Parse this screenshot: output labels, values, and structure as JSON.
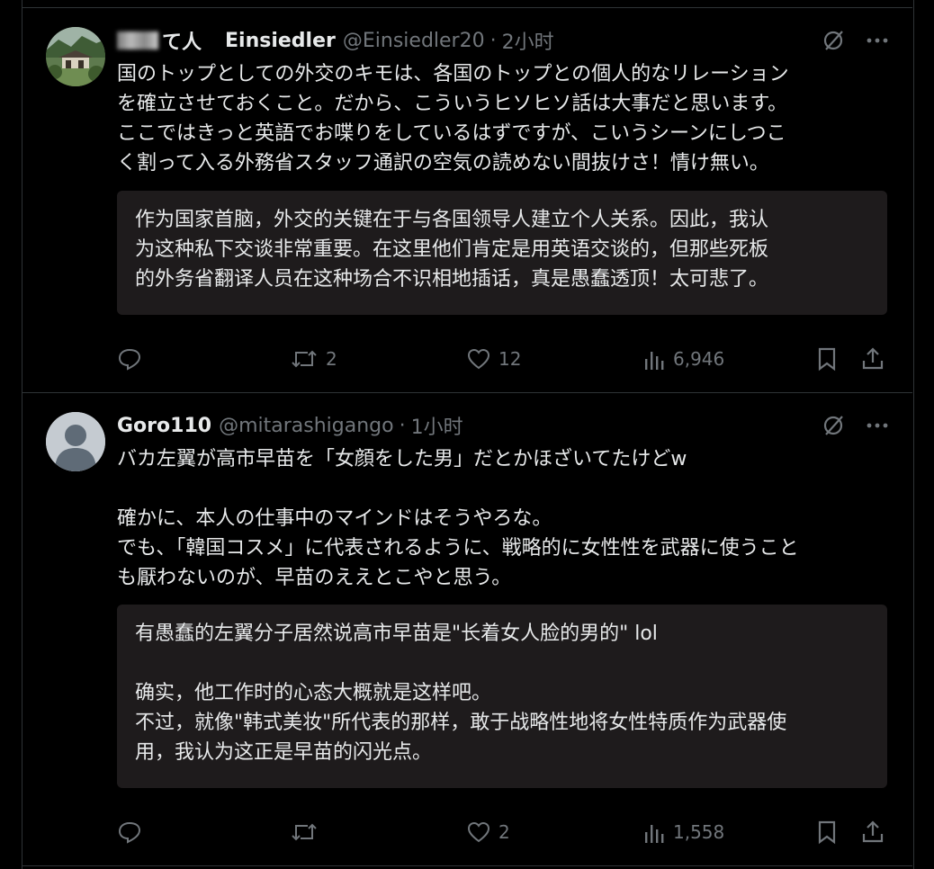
{
  "tweets": [
    {
      "display_name": "て人",
      "name": "Einsiedler",
      "handle": "@Einsiedler20",
      "sep": "·",
      "time": "2小时",
      "body": "国のトップとしての外交のキモは、各国のトップとの個人的なリレーション\nを確立させておくこと。だから、こういうヒソヒソ話は大事だと思います。\nここではきっと英語でお喋りをしているはずですが、こいうシーンにしつこ\nく割って入る外務省スタッフ通訳の空気の読めない間抜けさ！情け無い。",
      "translation": "作为国家首脑，外交的关键在于与各国领导人建立个人关系。因此，我认\n为这种私下交谈非常重要。在这里他们肯定是用英语交谈的，但那些死板\n的外务省翻译人员在这种场合不识相地插话，真是愚蠢透顶！太可悲了。",
      "replies": "",
      "retweets": "2",
      "likes": "12",
      "views": "6,946"
    },
    {
      "name": "Goro110",
      "handle": "@mitarashigango",
      "sep": "·",
      "time": "1小时",
      "body": "バカ左翼が高市早苗を「女顔をした男」だとかほざいてたけどw\n\n確かに、本人の仕事中のマインドはそうやろな。\nでも、「韓国コスメ」に代表されるように、戦略的に女性性を武器に使うこと\nも厭わないのが、早苗のええとこやと思う。",
      "translation": "有愚蠢的左翼分子居然说高市早苗是\"长着女人脸的男的\" lol\n\n确实，他工作时的心态大概就是这样吧。\n不过，就像\"韩式美妆\"所代表的那样，敢于战略性地将女性特质作为武器使\n用，我认为这正是早苗的闪光点。",
      "replies": "",
      "retweets": "",
      "likes": "2",
      "views": "1,558"
    }
  ],
  "icons": {
    "grok": "grok-icon",
    "more": "more-icon",
    "reply": "reply-icon",
    "retweet": "retweet-icon",
    "like": "like-icon",
    "views": "views-icon",
    "bookmark": "bookmark-icon",
    "share": "share-icon"
  },
  "colors": {
    "background": "#000000",
    "muted": "#71767b",
    "text": "#e7e9ea",
    "translation_bg": "#1e1b1c",
    "border": "#2f3336"
  }
}
